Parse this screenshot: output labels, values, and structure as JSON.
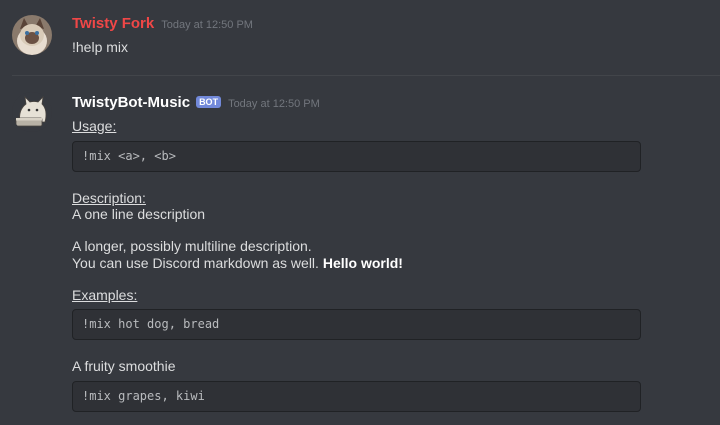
{
  "colors": {
    "background": "#36393f",
    "user_name_color": "#f04747",
    "bot_name_color": "#ffffff",
    "bot_tag": "#7289da",
    "codeblock_bg": "#2f3136"
  },
  "messages": [
    {
      "author": "Twisty Fork",
      "timestamp": "Today at 12:50 PM",
      "avatar_icon": "cat-avatar-icon",
      "content": "!help mix"
    },
    {
      "author": "TwistyBot-Music",
      "bot_tag": "BOT",
      "timestamp": "Today at 12:50 PM",
      "avatar_icon": "bot-cat-avatar-icon",
      "usage_label": "Usage:",
      "usage_code": "!mix <a>, <b>",
      "description_label": "Description:",
      "description_line1": "A one line description",
      "longer_line1": "A longer, possibly multiline description.",
      "longer_line2": "You can use Discord markdown as well. ",
      "longer_bold": "Hello world!",
      "examples_label": "Examples:",
      "example1_code": "!mix hot dog, bread",
      "example2_caption": "A fruity smoothie",
      "example2_code": "!mix grapes, kiwi"
    }
  ]
}
